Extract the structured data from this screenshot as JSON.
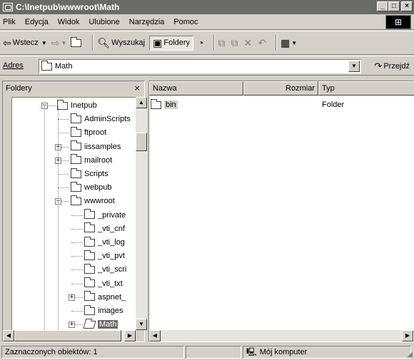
{
  "window": {
    "title": "C:\\Inetpub\\wwwroot\\Math"
  },
  "menu": [
    "Plik",
    "Edycja",
    "Widok",
    "Ulubione",
    "Narzędzia",
    "Pomoc"
  ],
  "toolbar": {
    "back": "Wstecz",
    "search": "Wyszukaj",
    "folders": "Foldery"
  },
  "address": {
    "label": "Adres",
    "value": "Math",
    "go": "Przejdź"
  },
  "folders_pane": {
    "title": "Foldery",
    "tree": [
      {
        "label": "Inetpub",
        "expander": "−"
      },
      {
        "label": "AdminScripts",
        "expander": ""
      },
      {
        "label": "ftproot",
        "expander": ""
      },
      {
        "label": "iissamples",
        "expander": "+"
      },
      {
        "label": "mailroot",
        "expander": "+"
      },
      {
        "label": "Scripts",
        "expander": ""
      },
      {
        "label": "webpub",
        "expander": ""
      },
      {
        "label": "wwwroot",
        "expander": "−"
      },
      {
        "label": "_private",
        "expander": ""
      },
      {
        "label": "_vti_cnf",
        "expander": ""
      },
      {
        "label": "_vti_log",
        "expander": ""
      },
      {
        "label": "_vti_pvt",
        "expander": ""
      },
      {
        "label": "_vti_scri",
        "expander": ""
      },
      {
        "label": "_vti_txt",
        "expander": ""
      },
      {
        "label": "aspnet_",
        "expander": "+"
      },
      {
        "label": "images",
        "expander": ""
      },
      {
        "label": "Math",
        "expander": "+"
      }
    ]
  },
  "file_list": {
    "columns": [
      "Nazwa",
      "Rozmiar",
      "Typ"
    ],
    "rows": [
      {
        "name": "bin",
        "size": "",
        "type": "Folder"
      }
    ]
  },
  "status": {
    "selected": "Zaznaczonych obiektów: 1",
    "location": "Mój komputer"
  }
}
